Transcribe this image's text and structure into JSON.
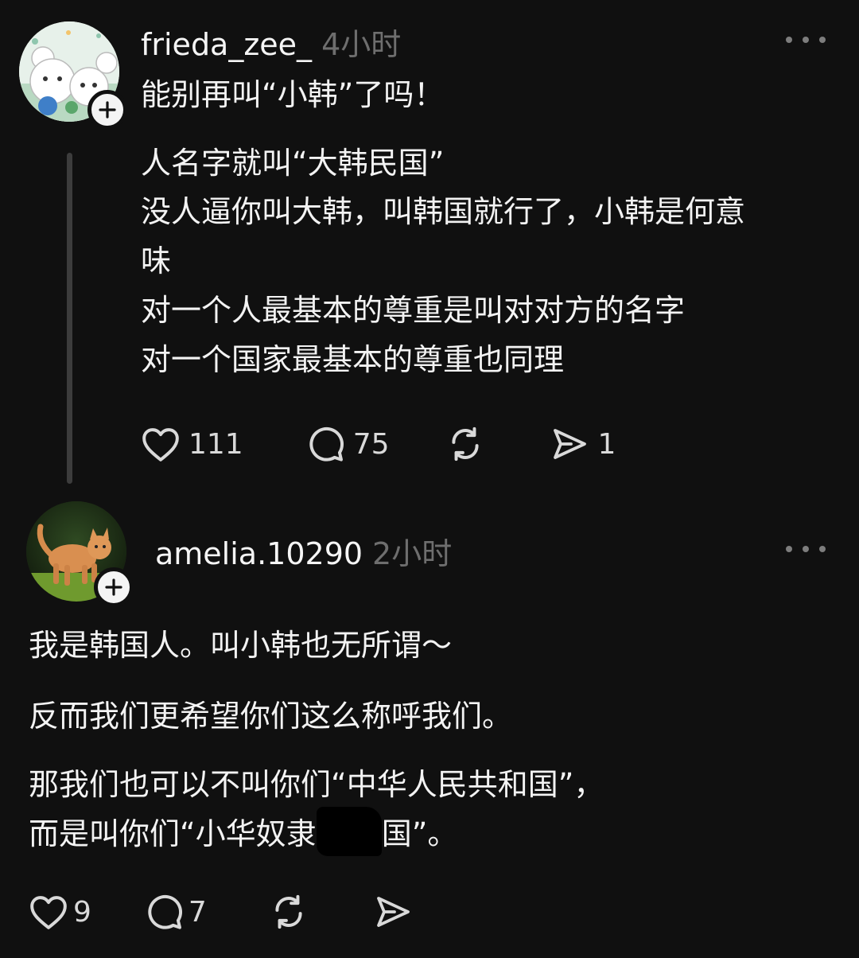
{
  "posts": [
    {
      "username": "frieda_zee_",
      "time": "4小时",
      "title": "能别再叫“小韩”了吗！",
      "body": [
        "人名字就叫“大韩民国”",
        "没人逼你叫大韩，叫韩国就行了，小韩是何意",
        "味",
        "对一个人最基本的尊重是叫对对方的名字",
        "对一个国家最基本的尊重也同理"
      ],
      "likes": "111",
      "comments": "75",
      "reposts": "",
      "shares": "1",
      "avatar_icon": "cartoon-mice-avatar"
    },
    {
      "username": "amelia.10290",
      "time": "2小时",
      "body": [
        "我是韩国人。叫小韩也无所谓～",
        "反而我们更希望你们这么称呼我们。",
        "那我们也可以不叫你们“中华人民共和国”，",
        "而是叫你们“小华奴隶",
        "国”。"
      ],
      "likes": "9",
      "comments": "7",
      "reposts": "",
      "shares": "",
      "avatar_icon": "kitten-photo-avatar"
    }
  ],
  "icons": {
    "follow": "plus-icon",
    "more": "more-dots-icon",
    "like": "heart-icon",
    "comment": "comment-bubble-icon",
    "repost": "repost-icon",
    "share": "send-icon"
  },
  "colors": {
    "background": "#101010",
    "text": "#f3f3f3",
    "muted": "#6e6e6e"
  }
}
